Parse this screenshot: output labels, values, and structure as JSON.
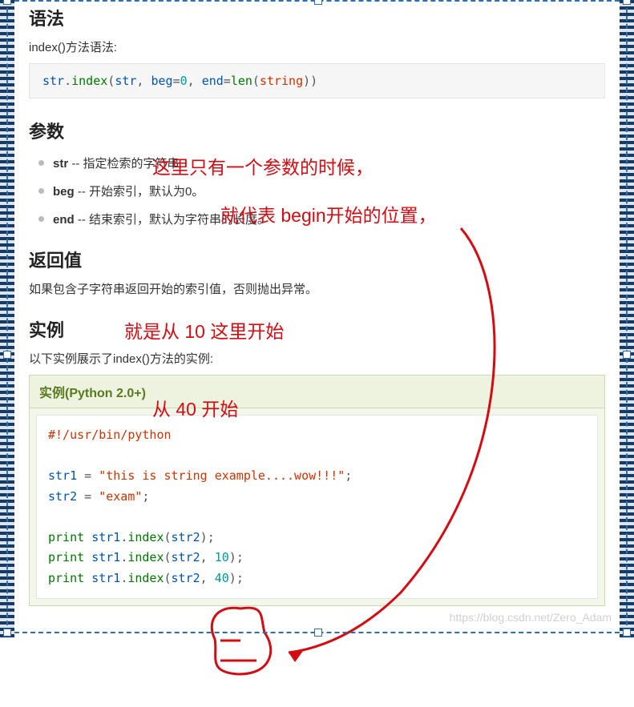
{
  "headings": {
    "syntax": "语法",
    "params": "参数",
    "return": "返回值",
    "example": "实例"
  },
  "text": {
    "syntax_desc": "index()方法语法:",
    "return_desc": "如果包含子字符串返回开始的索引值，否则抛出异常。",
    "example_desc": "以下实例展示了index()方法的实例:"
  },
  "syntax_code": {
    "obj": "str",
    "dot": ".",
    "fn": "index",
    "open": "(",
    "arg1": "str",
    "comma1": ", ",
    "arg2": "beg",
    "eq1": "=",
    "zero": "0",
    "comma2": ", ",
    "arg3": "end",
    "eq2": "=",
    "len": "len",
    "open2": "(",
    "string": "string",
    "close2": ")",
    "close": ")"
  },
  "params": [
    {
      "name": "str",
      "sep": " -- ",
      "desc": "指定检索的字符串"
    },
    {
      "name": "beg",
      "sep": " -- ",
      "desc": "开始索引，默认为0。"
    },
    {
      "name": "end",
      "sep": " -- ",
      "desc": "结束索引，默认为字符串的长度。"
    }
  ],
  "example_header": "实例(Python 2.0+)",
  "example_code": {
    "shebang": "#!/usr/bin/python",
    "str1_name": "str1",
    "eq": " = ",
    "str1_val": "\"this is string example....wow!!!\"",
    "semi": ";",
    "str2_name": "str2",
    "str2_val": "\"exam\"",
    "print": "print",
    "dot": ".",
    "index": "index",
    "open": "(",
    "close": ")",
    "comma": ", ",
    "ten": "10",
    "forty": "40"
  },
  "annotations": {
    "a1": "这里只有一个参数的时候，",
    "a2": "就代表 begin开始的位置，",
    "a3": "就是从 10 这里开始",
    "a4": "从 40 开始"
  },
  "watermark": "https://blog.csdn.net/Zero_Adam"
}
